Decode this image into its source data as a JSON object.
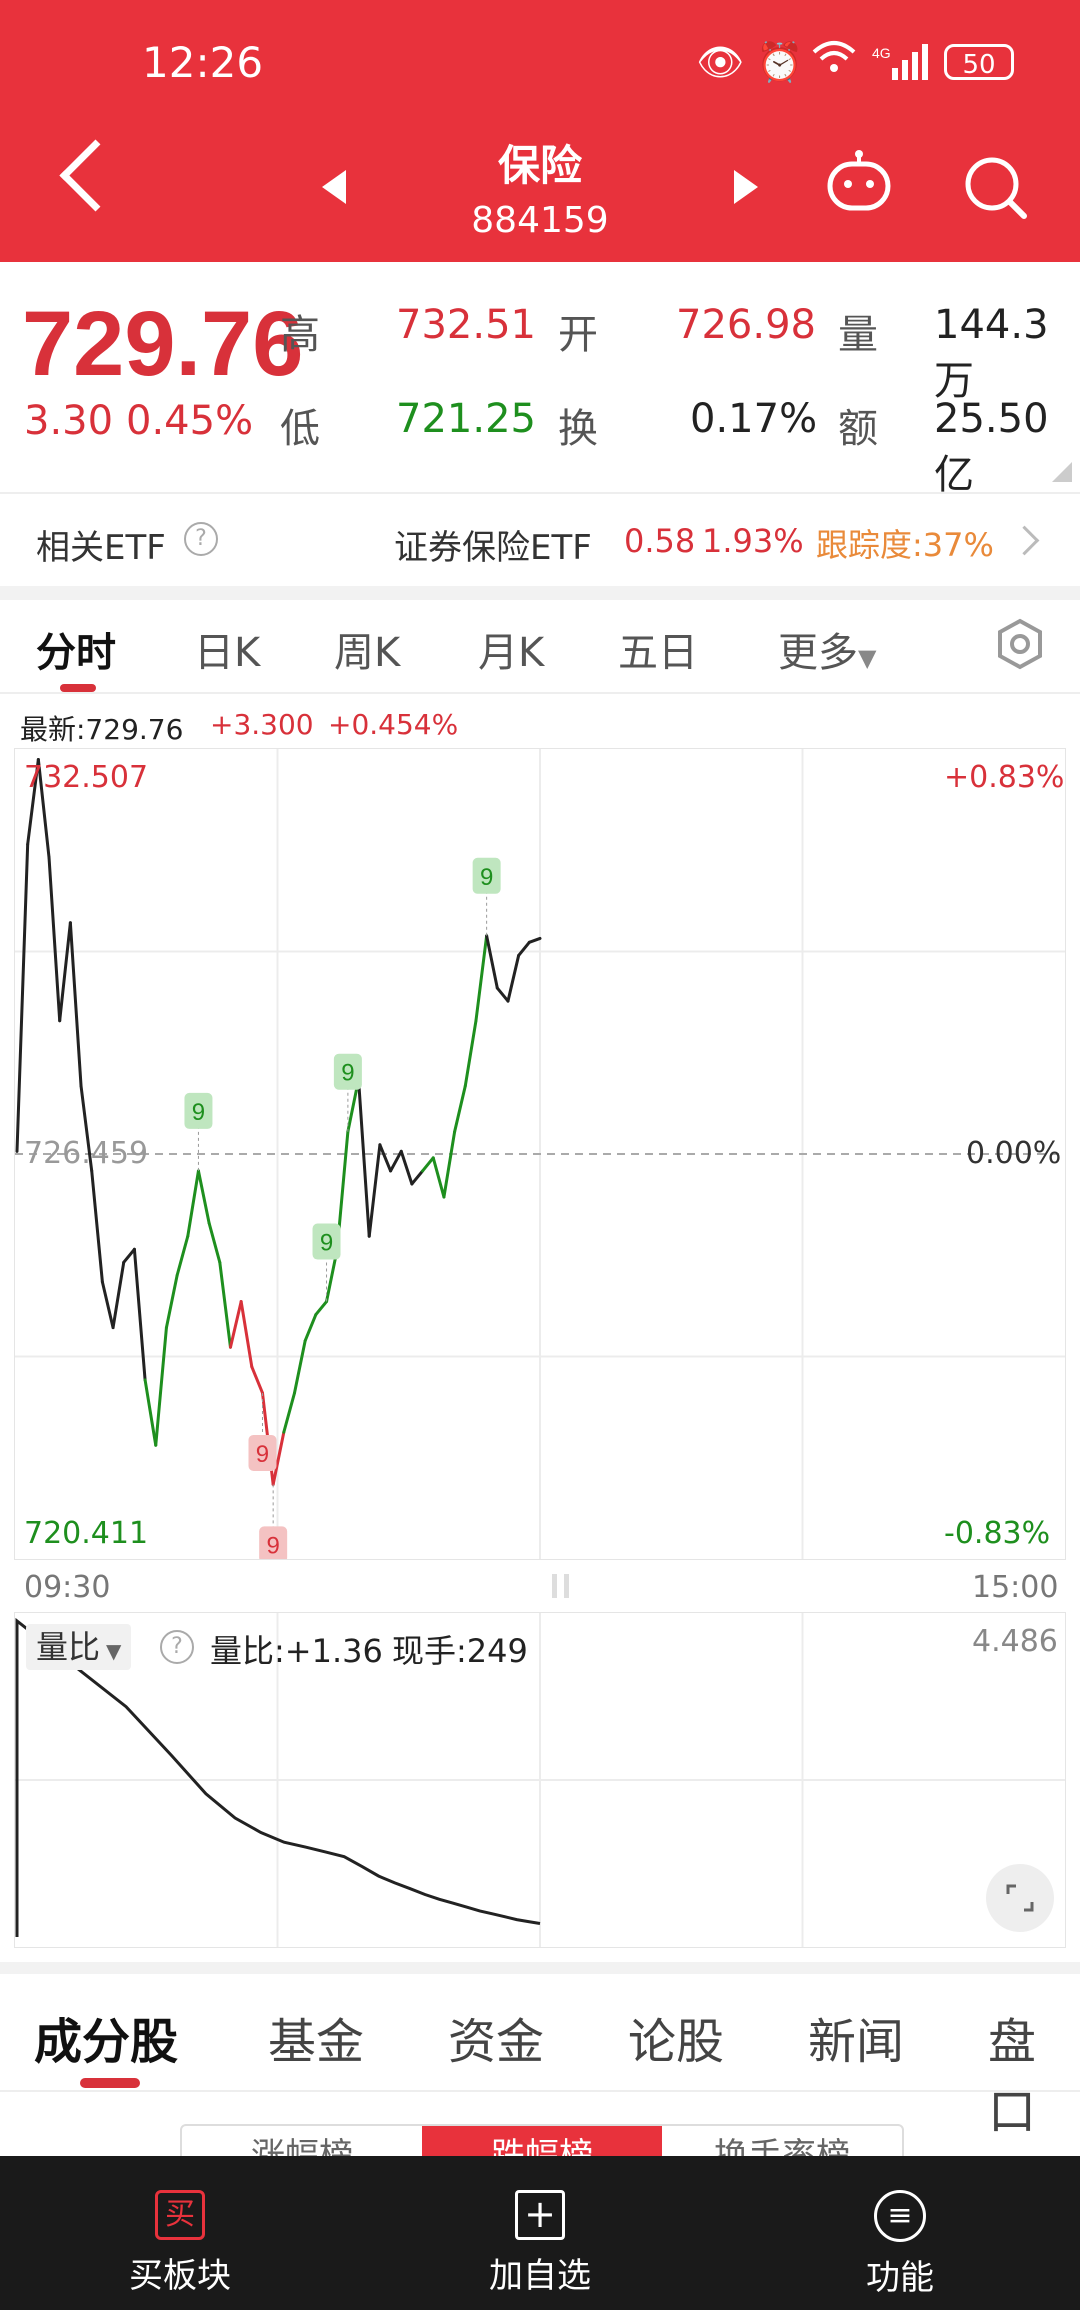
{
  "status_bar": {
    "time": "12:26",
    "battery": "50"
  },
  "header": {
    "title": "保险",
    "code": "884159"
  },
  "quote": {
    "price": "729.76",
    "change": "3.30",
    "change_pct": "0.45%",
    "stats": [
      {
        "label": "高",
        "value": "732.51",
        "color": "#D8313A"
      },
      {
        "label": "开",
        "value": "726.98",
        "color": "#D8313A"
      },
      {
        "label": "量",
        "value": "144.3万",
        "color": "#222222"
      },
      {
        "label": "低",
        "value": "721.25",
        "color": "#1E8F1E"
      },
      {
        "label": "换",
        "value": "0.17%",
        "color": "#222222"
      },
      {
        "label": "额",
        "value": "25.50亿",
        "color": "#222222"
      }
    ]
  },
  "etf": {
    "label": "相关ETF",
    "help": "?",
    "name": "证券保险ETF",
    "price": "0.58",
    "pct": "1.93%",
    "tracking": "跟踪度:37%"
  },
  "chart_tabs": [
    "分时",
    "日K",
    "周K",
    "月K",
    "五日",
    "更多"
  ],
  "chart_info": {
    "label": "最新:729.76",
    "change": "+3.300",
    "pct": "+0.454%"
  },
  "chart_labels": {
    "high": "732.507",
    "mid": "726.459",
    "low": "720.411",
    "high_pct": "+0.83%",
    "mid_pct": "0.00%",
    "low_pct": "-0.83%",
    "start_time": "09:30",
    "end_time": "15:00",
    "signal": "9"
  },
  "volume_panel": {
    "selector": "量比",
    "help": "?",
    "info": "量比:+1.36",
    "hand": "现手:249",
    "max": "4.486"
  },
  "content_tabs": [
    "成分股",
    "基金",
    "资金",
    "论股",
    "新闻",
    "盘口"
  ],
  "segmented": [
    "涨幅榜",
    "跌幅榜",
    "换手率榜"
  ],
  "bottom_nav": [
    {
      "label": "买板块",
      "icon": "买"
    },
    {
      "label": "加自选",
      "icon": "+"
    },
    {
      "label": "功能",
      "icon": "≡"
    }
  ],
  "colors": {
    "brand": "#E8323C",
    "up": "#D8313A",
    "down": "#1E8F1E"
  },
  "chart_data": {
    "type": "line",
    "x_range": [
      "09:30",
      "15:00"
    ],
    "ylim": [
      720.411,
      732.507
    ],
    "reference": 726.459,
    "series": [
      {
        "values": [
          726.5,
          731.2,
          732.5,
          731.0,
          728.5,
          730.0,
          727.5,
          726.2,
          724.5,
          723.8,
          724.8,
          725.0,
          723.0,
          722.0,
          723.8,
          724.6,
          725.2,
          726.2,
          725.4,
          724.8,
          723.5,
          724.2,
          723.2,
          722.8,
          721.4,
          722.2,
          722.8,
          723.6,
          724.0,
          724.2,
          725.0,
          726.8,
          727.6,
          725.2,
          726.6,
          726.2,
          726.5,
          726.0,
          726.2,
          726.4,
          725.8,
          726.8,
          727.5,
          728.5,
          729.8,
          729.0,
          728.8,
          729.5,
          729.7,
          729.76
        ]
      }
    ],
    "volume_ratio": [
      4.486,
      3.6,
      3.1,
      2.7,
      2.45,
      2.3,
      2.2,
      2.15,
      2.1,
      2.05,
      1.95,
      1.85,
      1.78,
      1.72,
      1.66,
      1.61,
      1.57,
      1.53,
      1.49,
      1.46,
      1.43,
      1.4,
      1.38,
      1.36
    ]
  }
}
